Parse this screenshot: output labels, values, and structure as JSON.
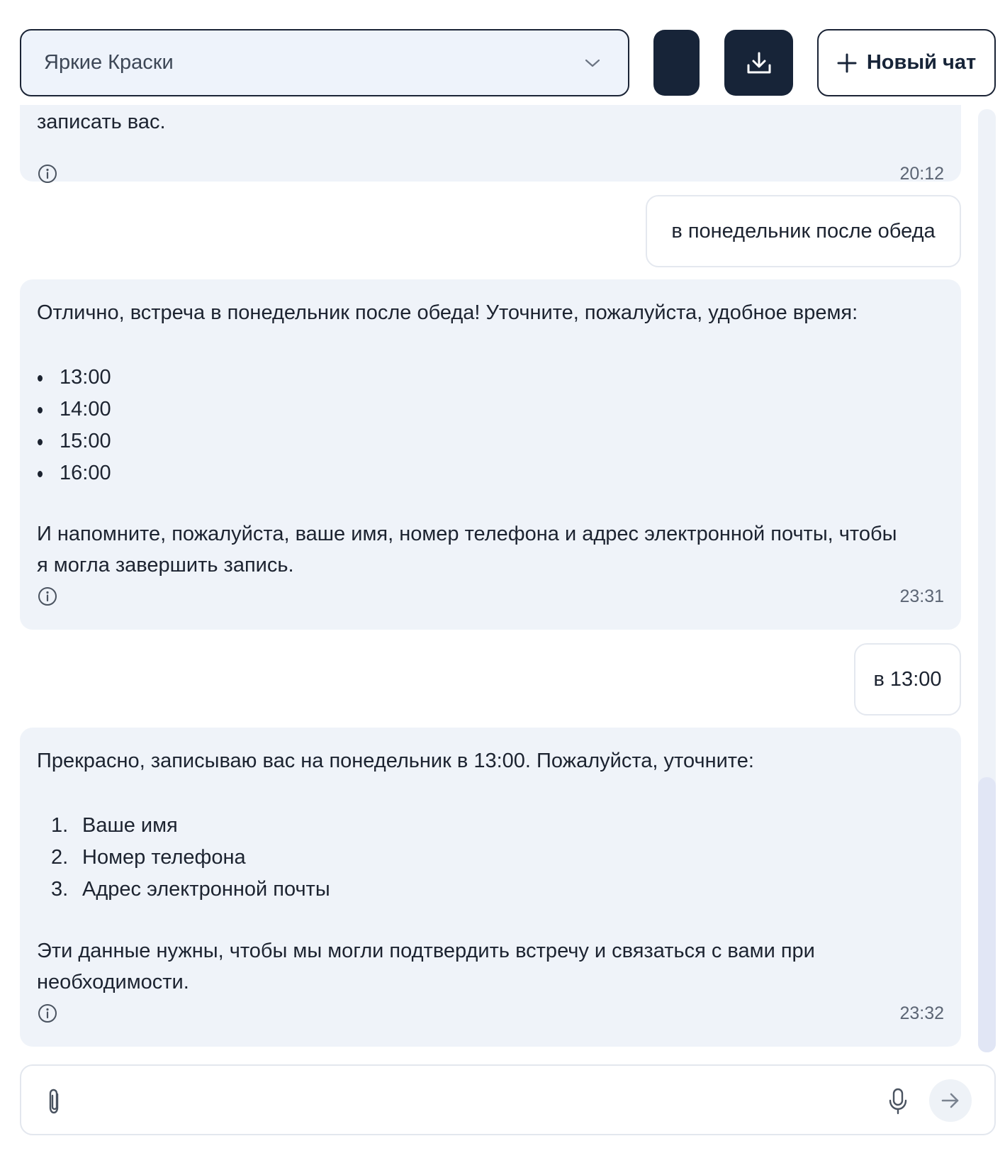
{
  "header": {
    "assistant_select": {
      "selected": "Яркие Краски"
    },
    "download_label": "download-icon",
    "new_chat_label": "Новый чат"
  },
  "messages": [
    {
      "role": "bot",
      "partial_text": "записать вас.",
      "time": "20:12"
    },
    {
      "role": "user",
      "text": "в понедельник после обеда"
    },
    {
      "role": "bot",
      "intro": "Отлично, встреча в понедельник после обеда! Уточните, пожалуйста, удобное время:",
      "options": [
        "13:00",
        "14:00",
        "15:00",
        "16:00"
      ],
      "outro_line1": "И напомните, пожалуйста, ваше имя, номер телефона и адрес электронной почты, чтобы",
      "outro_line2": "я могла завершить запись.",
      "time": "23:31"
    },
    {
      "role": "user",
      "text": "в 13:00"
    },
    {
      "role": "bot",
      "intro": "Прекрасно, записываю вас на понедельник в 13:00. Пожалуйста, уточните:",
      "items": [
        {
          "num": "1.",
          "text": "Ваше имя"
        },
        {
          "num": "2.",
          "text": "Номер телефона"
        },
        {
          "num": "3.",
          "text": "Адрес электронной почты"
        }
      ],
      "outro_line1": "Эти данные нужны, чтобы мы могли подтвердить встречу и связаться с вами при",
      "outro_line2": "необходимости.",
      "time": "23:32"
    }
  ],
  "composer": {
    "placeholder": ""
  },
  "icons": {
    "select": "chevron-down-icon",
    "download": "download-icon",
    "new_chat": "plus-icon",
    "info": "info-icon",
    "attach": "paperclip-icon",
    "mic": "microphone-icon",
    "send": "arrow-right-icon"
  },
  "colors": {
    "dark": "#172438",
    "bot_bubble": "#eff3f9",
    "select_bg": "#eef3fb",
    "border": "#e4e8ef"
  }
}
